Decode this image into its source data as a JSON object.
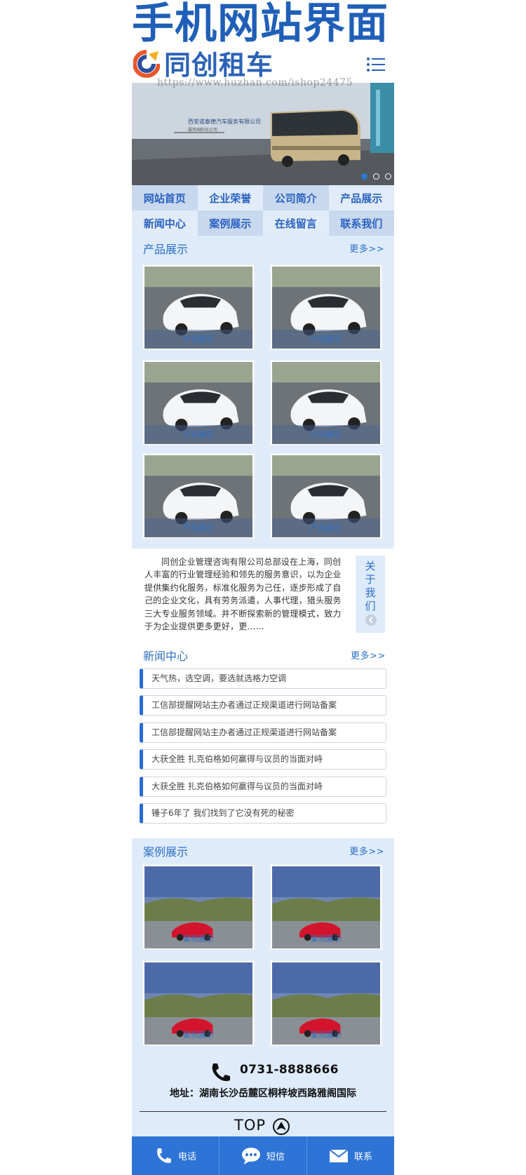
{
  "header": {
    "big_title": "手机网站界面",
    "logo_text": "同创租车",
    "watermark": "https://www.huzhan.com/ishop24475"
  },
  "banner": {
    "company": "西安诺泰德汽车服务有限公司",
    "company_sub": "服务国际化公司",
    "active_slide": 1,
    "slides": 3
  },
  "nav": {
    "items": [
      {
        "label": "网站首页"
      },
      {
        "label": "企业荣誉"
      },
      {
        "label": "公司简介"
      },
      {
        "label": "产品展示"
      },
      {
        "label": "新闻中心"
      },
      {
        "label": "案例展示"
      },
      {
        "label": "在线留言"
      },
      {
        "label": "联系我们"
      }
    ]
  },
  "products": {
    "title": "产品展示",
    "more": "更多>>",
    "items": [
      {
        "caption": "产品展示"
      },
      {
        "caption": "产品展示"
      },
      {
        "caption": "产品展示"
      },
      {
        "caption": "产品展示"
      },
      {
        "caption": "产品展示"
      },
      {
        "caption": "产品展示"
      }
    ]
  },
  "about": {
    "text": "同创企业管理咨询有限公司总部设在上海，同创人丰富的行业管理经验和领先的服务意识，以为企业提供集约化服务，标准化服务为己任，逐步形成了自己的企业文化，具有劳务派遣，人事代理，猎头服务三大专业服务领域。并不断探索新的管理模式，致力于为企业提供更多更好，更…...",
    "tab": "关于我们"
  },
  "news": {
    "title": "新闻中心",
    "more": "更多>>",
    "items": [
      {
        "title": "天气热，选空调，要选就选格力空调"
      },
      {
        "title": "工信部提醒网站主办者通过正规渠道进行网站备案"
      },
      {
        "title": "工信部提醒网站主办者通过正规渠道进行网站备案"
      },
      {
        "title": "大获全胜 扎克伯格如何赢得与议员的当面对峙"
      },
      {
        "title": "大获全胜 扎克伯格如何赢得与议员的当面对峙"
      },
      {
        "title": "锤子6年了 我们找到了它没有死的秘密"
      }
    ]
  },
  "cases": {
    "title": "案例展示",
    "more": "更多>>",
    "items": [
      {
        "caption": "案例展示"
      },
      {
        "caption": "案例展示"
      },
      {
        "caption": "案例展示"
      },
      {
        "caption": "案例展示"
      }
    ]
  },
  "footer": {
    "phone": "0731-8888666",
    "address": "地址：湖南长沙岳麓区桐梓坡西路雅阁国际",
    "top": "TOP"
  },
  "bottom_bar": {
    "call": "电话",
    "sms": "短信",
    "contact": "联系"
  },
  "colors": {
    "brand_blue": "#2e74d6",
    "section_bg": "#deebfb",
    "title_blue": "#1f5fb8"
  }
}
